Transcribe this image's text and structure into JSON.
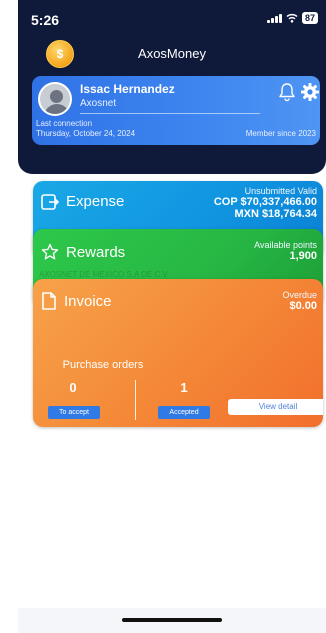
{
  "status_bar": {
    "time": "5:26",
    "battery": "87"
  },
  "app": {
    "title": "AxosMoney"
  },
  "profile": {
    "name": "Issac Hernandez",
    "company": "Axosnet",
    "last_connection_label": "Last connection",
    "last_connection_date": "Thursday, October 24, 2024",
    "member_since": "Member since 2023"
  },
  "cards": {
    "expense": {
      "title": "Expense",
      "status": "Unsubmitted Valid",
      "amount_cop": "COP $70,337,466.00",
      "amount_mxn": "MXN $18,764.34"
    },
    "rewards": {
      "title": "Rewards",
      "points_label": "Available points",
      "points": "1,900",
      "company_faint": "AXOSNET DE MEXICO S.A DE C.V."
    },
    "invoice": {
      "title": "Invoice",
      "status": "Overdue",
      "amount": "$0.00",
      "purchase_orders_label": "Purchase orders",
      "to_accept_count": "0",
      "to_accept_label": "To accept",
      "accepted_count": "1",
      "accepted_label": "Accepted",
      "view_detail_label": "View detail"
    }
  },
  "colors": {
    "header_bg": "#0f1a3a",
    "profile_card": "#3f86f0",
    "expense_card": "#1094e0",
    "rewards_card": "#27b644",
    "invoice_card": "#f48a38",
    "pill_blue": "#2f7ae5"
  },
  "icons": {
    "coin": "coin-icon",
    "avatar": "avatar-icon",
    "bell": "bell-icon",
    "gear": "gear-icon",
    "expense": "expense-icon",
    "rewards": "star-icon",
    "invoice": "document-icon"
  }
}
